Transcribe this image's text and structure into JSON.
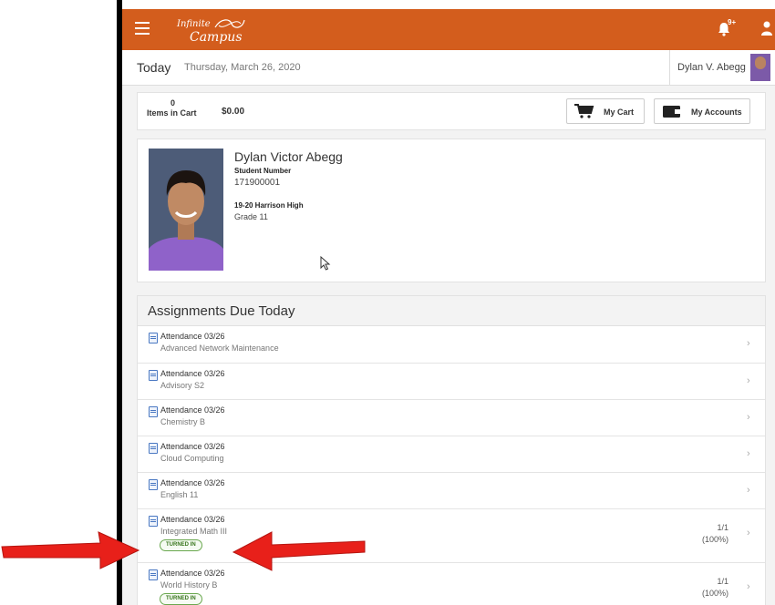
{
  "app": {
    "logo_line1": "Infinite",
    "logo_line2": "Campus",
    "notification_badge": "9+"
  },
  "header": {
    "today_label": "Today",
    "date": "Thursday, March 26, 2020",
    "user_name": "Dylan V. Abegg"
  },
  "cart": {
    "count": "0",
    "label": "Items in Cart",
    "total": "$0.00",
    "my_cart_label": "My Cart",
    "my_accounts_label": "My Accounts"
  },
  "student": {
    "name": "Dylan Victor Abegg",
    "number_label": "Student Number",
    "number": "171900001",
    "school": "19-20 Harrison High",
    "grade": "Grade 11"
  },
  "assignments": {
    "title": "Assignments Due Today",
    "items": [
      {
        "name": "Attendance 03/26",
        "course": "Advanced Network Maintenance"
      },
      {
        "name": "Attendance 03/26",
        "course": "Advisory S2"
      },
      {
        "name": "Attendance 03/26",
        "course": "Chemistry B"
      },
      {
        "name": "Attendance 03/26",
        "course": "Cloud Computing"
      },
      {
        "name": "Attendance 03/26",
        "course": "English 11"
      },
      {
        "name": "Attendance 03/26",
        "course": "Integrated Math III",
        "status": "TURNED IN",
        "score": "1/1",
        "percent": "(100%)"
      },
      {
        "name": "Attendance 03/26",
        "course": "World History B",
        "status": "TURNED IN",
        "score": "1/1",
        "percent": "(100%)"
      }
    ]
  },
  "icons": {
    "menu": "hamburger-icon",
    "bell": "bell-icon",
    "user": "user-icon",
    "cart": "cart-icon",
    "wallet": "wallet-icon",
    "doc": "document-icon",
    "chevron": "chevron-right-icon"
  },
  "colors": {
    "brand": "#d35d1d",
    "turned_in": "#6aa84f",
    "annotation_arrow": "#e8201a"
  }
}
